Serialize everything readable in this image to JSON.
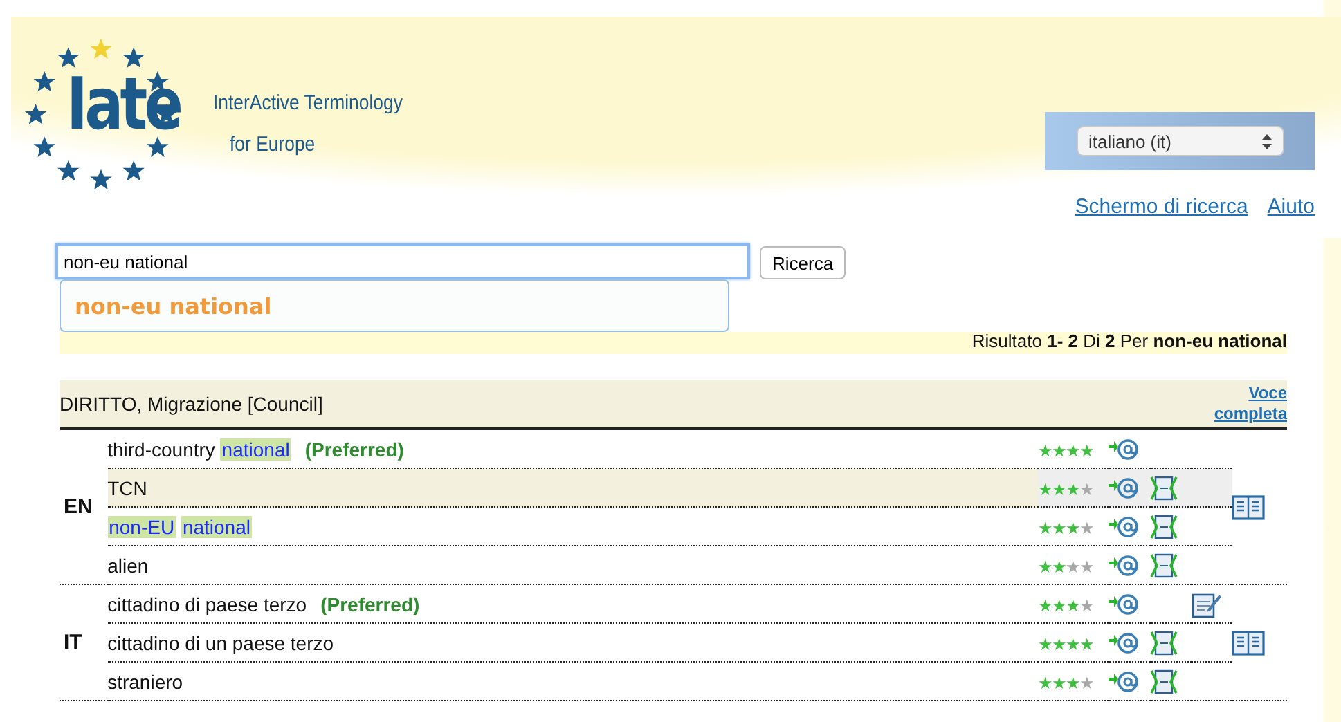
{
  "logo": {
    "wordmark": "Iate",
    "tagline_lines": [
      "InterActive Terminology",
      "for Europe"
    ]
  },
  "language_select": {
    "value": "italiano (it)"
  },
  "links": [
    "Schermo di ricerca",
    "Aiuto"
  ],
  "search": {
    "value": "non-eu national",
    "button": "Ricerca",
    "suggestions": [
      "non-eu national"
    ]
  },
  "result_summary": "Risultato **1- 2** Di **2** Per **non-eu national**",
  "entry": {
    "domain": "DIRITTO, Migrazione [Council]",
    "full_entry_link": "Voce completa",
    "languages": [
      {
        "code": "EN",
        "terms": [
          {
            "segments": [
              {
                "text": "third-country",
                "match": false
              },
              {
                "text": "national",
                "match": true
              }
            ],
            "note": "(Preferred)",
            "stars": 4,
            "highlighted": false,
            "context": false,
            "comment": false
          },
          {
            "segments": [
              {
                "text": "TCN",
                "match": false
              }
            ],
            "highlighted": true,
            "stars": 3,
            "context": true,
            "comment": false
          },
          {
            "segments": [
              {
                "text": "non-EU",
                "match": true
              },
              {
                "text": "national",
                "match": true
              }
            ],
            "highlighted": false,
            "stars": 3,
            "context": true,
            "comment": false
          },
          {
            "segments": [
              {
                "text": "alien",
                "match": false
              }
            ],
            "highlighted": false,
            "stars": 2,
            "context": true,
            "comment": false
          }
        ]
      },
      {
        "code": "IT",
        "terms": [
          {
            "segments": [
              {
                "text": "cittadino di paese terzo",
                "match": false
              }
            ],
            "note": "(Preferred)",
            "stars": 3,
            "highlighted": false,
            "context": false,
            "comment": true
          },
          {
            "segments": [
              {
                "text": "cittadino di un paese terzo",
                "match": false
              }
            ],
            "highlighted": false,
            "stars": 4,
            "context": true,
            "comment": false
          },
          {
            "segments": [
              {
                "text": "straniero",
                "match": false
              }
            ],
            "highlighted": false,
            "stars": 3,
            "context": true,
            "comment": false
          }
        ]
      }
    ]
  }
}
